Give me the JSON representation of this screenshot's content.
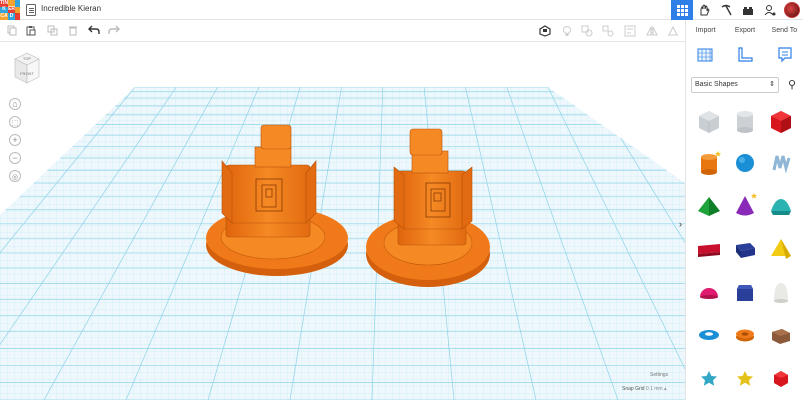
{
  "app": {
    "logo_letters": [
      "TIN",
      "K",
      "ER",
      "CA",
      "D",
      ""
    ],
    "project_title": "Incredible Kieran"
  },
  "topbar_icons": [
    "grid-view-icon",
    "hand-icon",
    "pickaxe-icon",
    "brick-icon",
    "user-icon",
    "avatar"
  ],
  "toolbar": {
    "left_icons": [
      "copy-icon",
      "paste-icon",
      "duplicate-icon",
      "delete-icon",
      "undo-icon",
      "redo-icon"
    ],
    "right_icons": [
      "notes-icon",
      "light-icon",
      "group-icon",
      "ungroup-icon",
      "align-icon",
      "mirror-icon",
      "cruise-icon"
    ]
  },
  "panel": {
    "import_label": "Import",
    "export_label": "Export",
    "send_to_label": "Send To",
    "library_select": "Basic Shapes",
    "shapes": [
      "box-striped",
      "cylinder-striped",
      "box",
      "cylinder",
      "sphere",
      "scribble",
      "pyramid",
      "cone",
      "roof",
      "text",
      "half-cylinder-block",
      "wedge-pyramid",
      "half-sphere",
      "polygon",
      "paraboloid",
      "torus",
      "tube",
      "shape-generator",
      "star",
      "star-gold",
      "icosahedron"
    ]
  },
  "viewport": {
    "viewcube_top": "TOP",
    "viewcube_front": "FRONT",
    "settings_label": "Settings",
    "snap_label": "Snap Grid",
    "snap_value": "0.1 mm"
  },
  "colors": {
    "accent": "#2f7fe8",
    "model_orange": "#f07818",
    "grid_line": "#8fd3e8",
    "workplane": "#d9f0f8"
  }
}
